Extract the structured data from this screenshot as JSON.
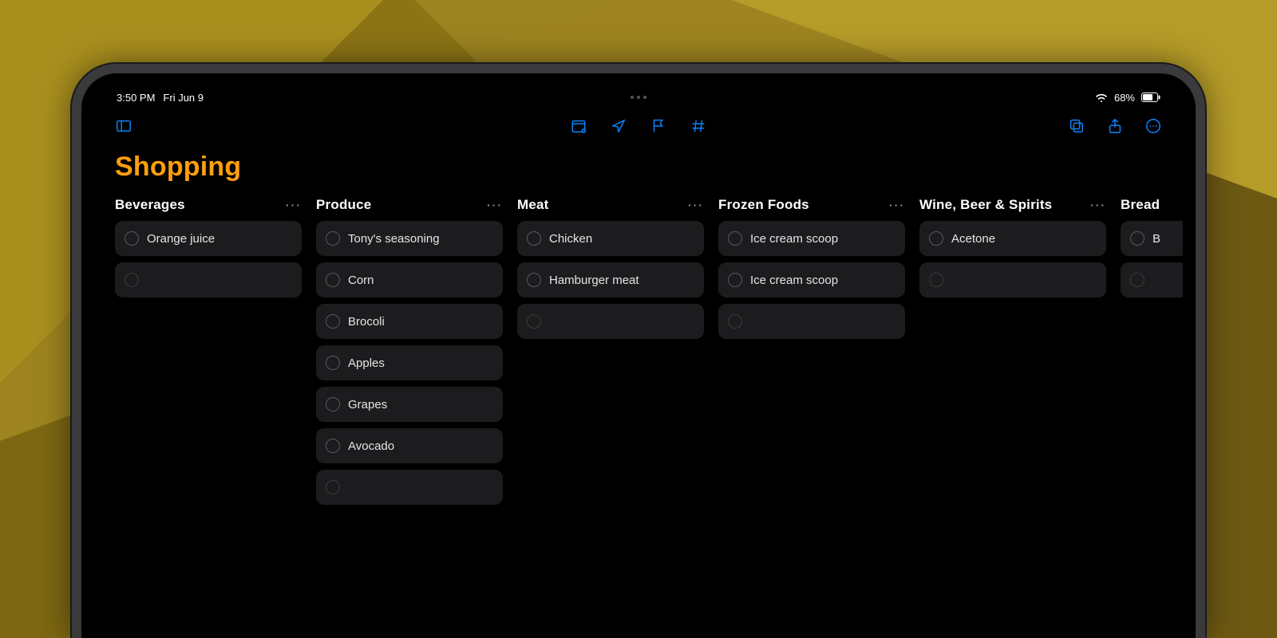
{
  "status": {
    "time": "3:50 PM",
    "date": "Fri Jun 9",
    "battery_pct": "68%"
  },
  "app": {
    "title": "Shopping"
  },
  "columns": [
    {
      "title": "Beverages",
      "items": [
        "Orange juice"
      ],
      "has_empty_trailer": true
    },
    {
      "title": "Produce",
      "items": [
        "Tony's seasoning",
        "Corn",
        "Brocoli",
        "Apples",
        "Grapes",
        "Avocado"
      ],
      "has_empty_trailer": true
    },
    {
      "title": "Meat",
      "items": [
        "Chicken",
        "Hamburger meat"
      ],
      "has_empty_trailer": true
    },
    {
      "title": "Frozen Foods",
      "items": [
        "Ice cream scoop",
        "Ice cream scoop"
      ],
      "has_empty_trailer": true
    },
    {
      "title": "Wine, Beer & Spirits",
      "items": [
        "Acetone"
      ],
      "has_empty_trailer": true
    },
    {
      "title": "Bread",
      "items": [
        "B"
      ],
      "has_empty_trailer": true
    }
  ]
}
